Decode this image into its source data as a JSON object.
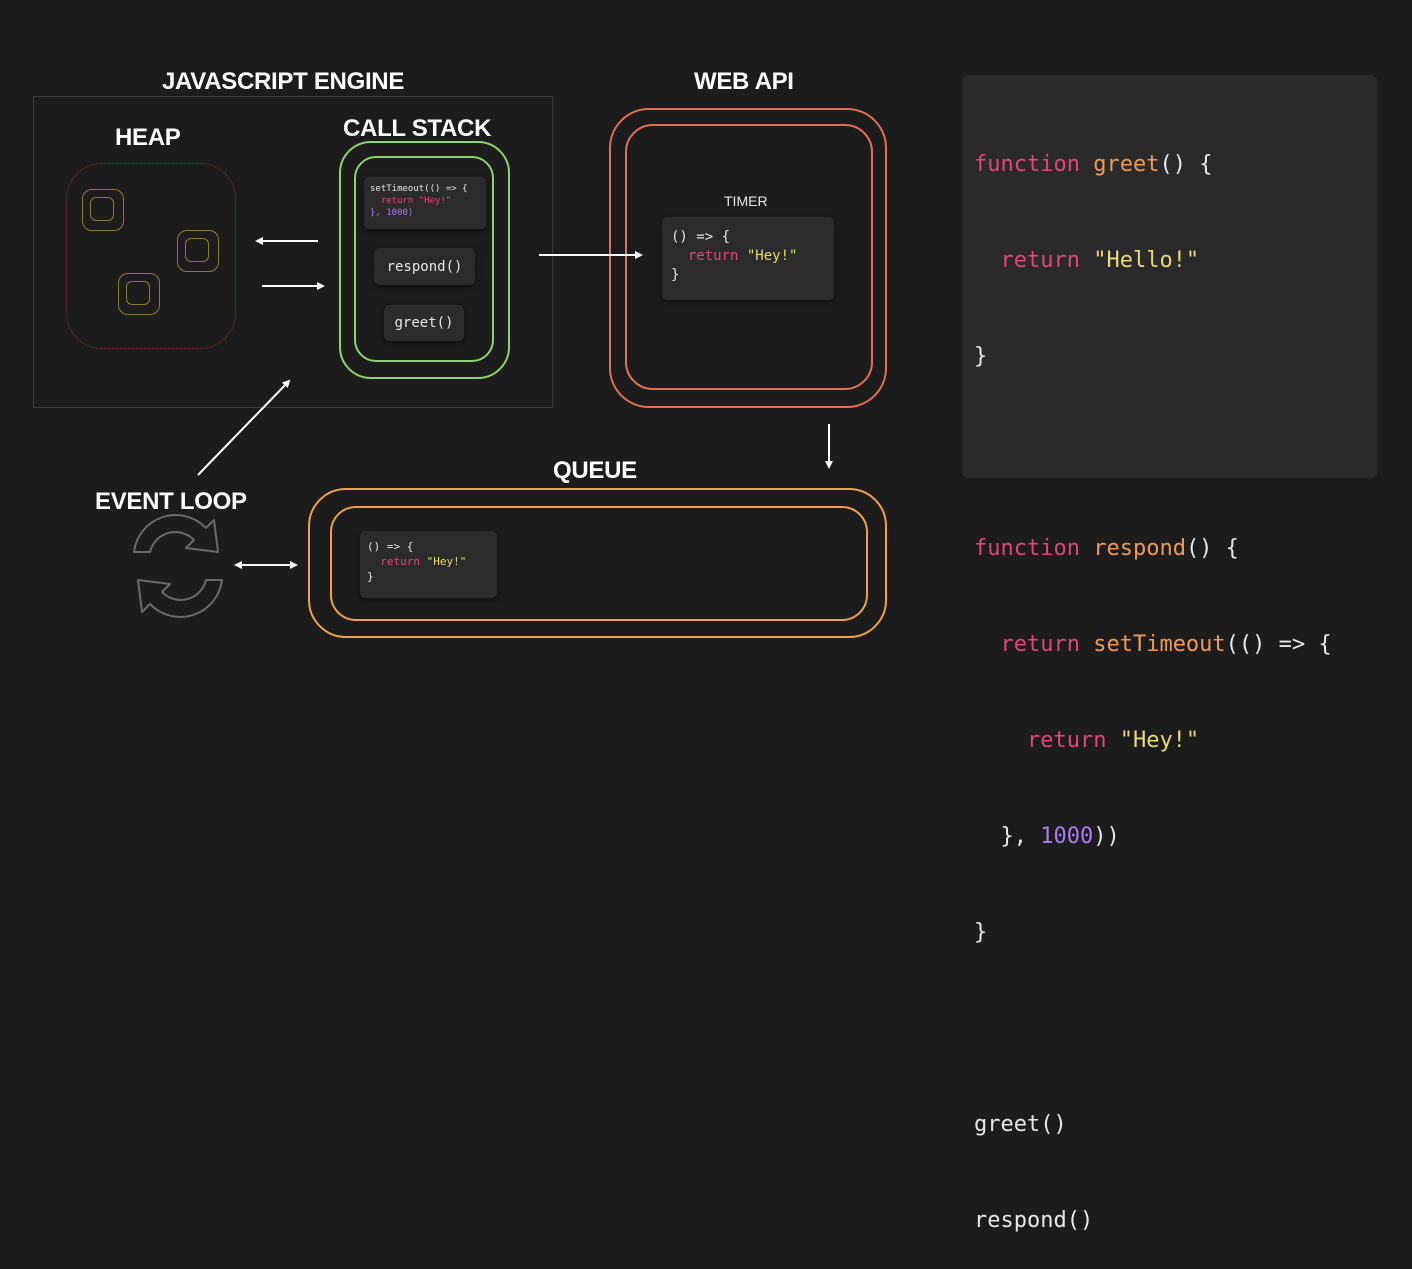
{
  "headings": {
    "engine": "JAVASCRIPT ENGINE",
    "heap": "HEAP",
    "call_stack": "CALL STACK",
    "web_api": "WEB API",
    "queue": "QUEUE",
    "event_loop": "EVENT LOOP"
  },
  "call_stack": {
    "timeout_frame": [
      "setTimeout(() => {",
      "  return \"Hey!\"",
      "}, 1000)"
    ],
    "respond_frame": "respond()",
    "greet_frame": "greet()"
  },
  "web_api": {
    "timer_label": "TIMER",
    "callback": [
      "() => {",
      "  return \"Hey!\"",
      "}"
    ]
  },
  "queue": {
    "callback": [
      "() => {",
      "  return \"Hey!\"",
      "}"
    ]
  },
  "code_panel": {
    "lines": [
      "function greet() {",
      "  return \"Hello!\"",
      "}",
      "",
      "function respond() {",
      "  return setTimeout(() => {",
      "    return \"Hey!\"",
      "  }, 1000))",
      "}",
      "",
      "greet()",
      "respond()"
    ]
  },
  "colors": {
    "background": "#1c1c1c",
    "call_stack_ring": "#8fd36a",
    "web_api_ring": "#e36f5a",
    "queue_ring": "#f0a24a",
    "keyword": "#e0457b",
    "function_name": "#f29a55",
    "string": "#e6db74",
    "number": "#ab7df5"
  }
}
